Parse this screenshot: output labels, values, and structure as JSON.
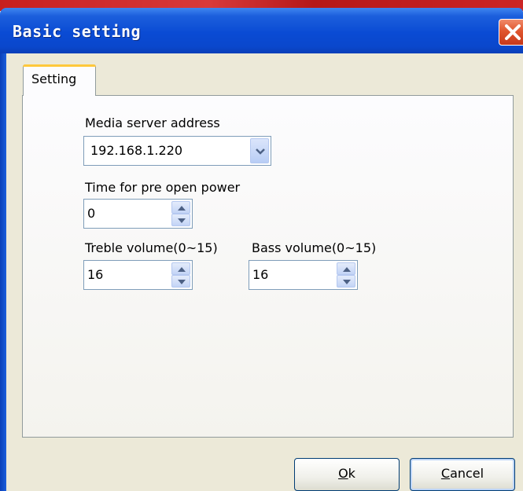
{
  "window": {
    "title": "Basic setting"
  },
  "tabs": [
    {
      "label": "Setting"
    }
  ],
  "media_server": {
    "label": "Media server address",
    "value": "192.168.1.220"
  },
  "pre_open": {
    "label": "Time for pre open power",
    "value": "0"
  },
  "treble": {
    "label": "Treble volume(0~15)",
    "value": "16"
  },
  "bass": {
    "label": "Bass volume(0~15)",
    "value": "16"
  },
  "buttons": {
    "ok": {
      "mnemonic": "O",
      "rest": "k"
    },
    "cancel": {
      "mnemonic": "C",
      "rest": "ancel"
    }
  },
  "icons": {
    "close": "close-icon",
    "dropdown": "chevron-down-icon",
    "spin_up": "arrow-up-icon",
    "spin_down": "arrow-down-icon"
  },
  "colors": {
    "titlebar": "#0a4bd4",
    "close": "#e0552e",
    "tab_accent": "#ffc83c"
  }
}
